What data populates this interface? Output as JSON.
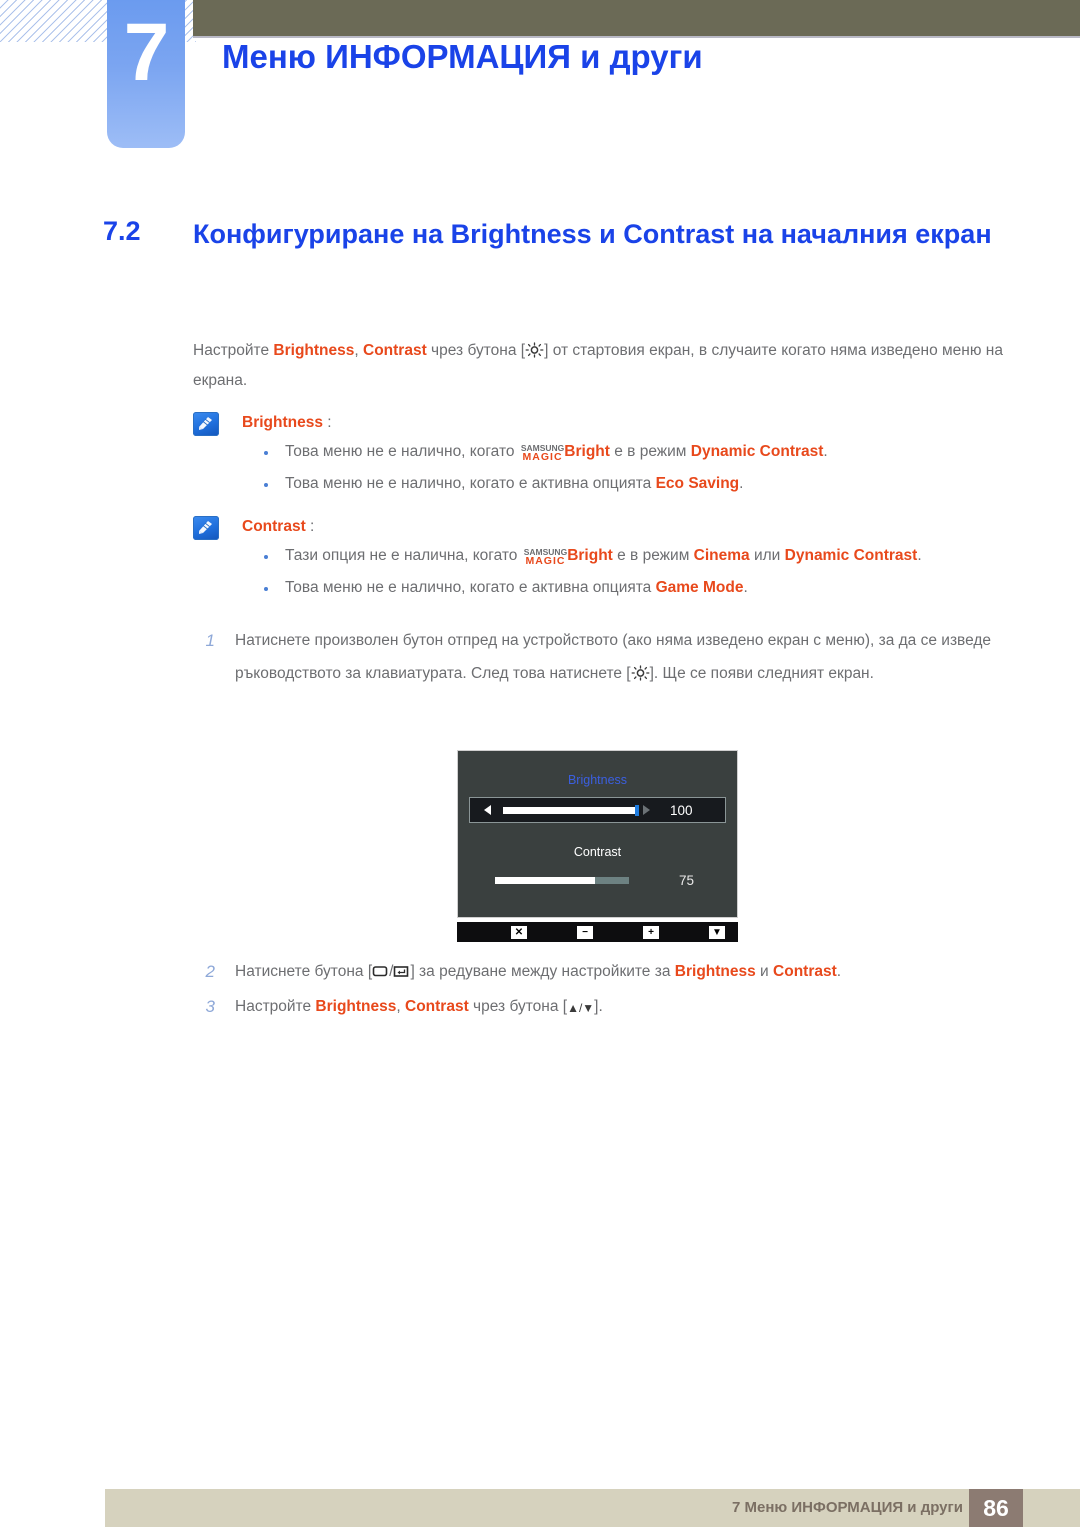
{
  "header": {
    "chapter_number": "7",
    "chapter_title": "Меню ИНФОРМАЦИЯ и други",
    "accent_color": "#1a43e8",
    "tab_color": "#7ba5f1",
    "bar_color": "#6b6a56"
  },
  "section": {
    "number": "7.2",
    "title": "Конфигуриране на Brightness и Contrast на началния екран"
  },
  "intro": {
    "part1": "Настройте ",
    "kw1": "Brightness",
    "sep1": ", ",
    "kw2": "Contrast",
    "part2": " чрез бутона [",
    "icon": "brightness-sun-icon",
    "part3": "] от стартовия екран, в случаите когато няма изведено меню на екрана."
  },
  "notes": [
    {
      "icon": "note-pencil-icon",
      "title": "Brightness",
      "colon": " :",
      "bullets": [
        {
          "pre": "Това меню не е налично, когато ",
          "magic_top": "SAMSUNG",
          "magic_bottom": "MAGIC",
          "magic_suffix": "Bright",
          "mid": " е в режим ",
          "kw": "Dynamic Contrast",
          "post": "."
        },
        {
          "pre": "Това меню не е налично, когато е активна опцията ",
          "kw": "Eco Saving",
          "post": "."
        }
      ]
    },
    {
      "icon": "note-pencil-icon",
      "title": "Contrast",
      "colon": " :",
      "bullets": [
        {
          "pre": "Тази опция не е налична, когато ",
          "magic_top": "SAMSUNG",
          "magic_bottom": "MAGIC",
          "magic_suffix": "Bright",
          "mid": " е в режим ",
          "kw": "Cinema",
          "mid2": " или ",
          "kw2": "Dynamic Contrast",
          "post": "."
        },
        {
          "pre": "Това меню не е налично, когато е активна опцията ",
          "kw": "Game Mode",
          "post": "."
        }
      ]
    }
  ],
  "steps": [
    {
      "num": "1",
      "text_a": "Натиснете произволен бутон отпред на устройството (ако няма изведено екран с меню), за да се изведе ръководството за клавиатурата. След това натиснете [",
      "icon": "brightness-sun-icon",
      "text_b": "]. Ще се появи следният екран."
    },
    {
      "num": "2",
      "text_a": "Натиснете бутона [",
      "icon_a": "monitor-icon",
      "slash": "/",
      "icon_b": "enter-key-icon",
      "text_b": "] за редуване между настройките за ",
      "kw1": "Brightness",
      "conj": " и ",
      "kw2": "Contrast",
      "text_c": "."
    },
    {
      "num": "3",
      "text_a": "Настройте ",
      "kw1": "Brightness",
      "sep": ", ",
      "kw2": "Contrast",
      "text_b": " чрез бутона [",
      "arrows": "▲/▼",
      "text_c": "]."
    }
  ],
  "osd": {
    "brightness_label": "Brightness",
    "brightness_value": "100",
    "contrast_label": "Contrast",
    "contrast_value": "75",
    "brightness_label_color": "#3b5fe0",
    "panel_color": "#3a403f",
    "keys": [
      {
        "glyph": "✕",
        "name": "close-key"
      },
      {
        "glyph": "−",
        "name": "minus-key"
      },
      {
        "glyph": "+",
        "name": "plus-key"
      },
      {
        "glyph": "▼",
        "name": "down-key"
      }
    ]
  },
  "footer": {
    "text": "7 Меню ИНФОРМАЦИЯ и други",
    "page": "86",
    "band_color": "#d6d2be",
    "page_box_color": "#8c7b72"
  }
}
